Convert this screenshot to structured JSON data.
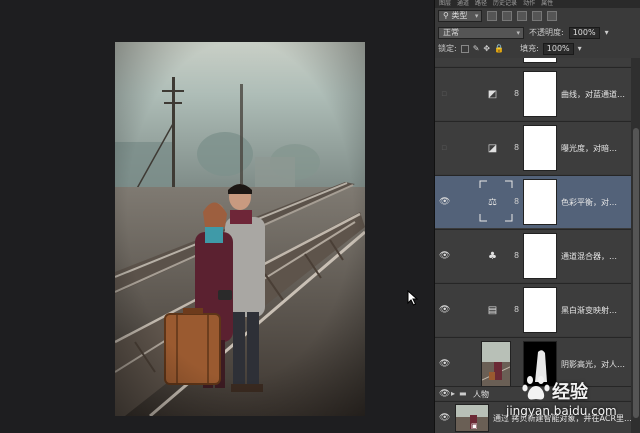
{
  "panel": {
    "tabs": [
      "图层",
      "通道",
      "路径",
      "历史记录",
      "动作",
      "属性"
    ],
    "filter_kind": "类型",
    "blend_mode": "正常",
    "opacity_label": "不透明度:",
    "opacity_value": "100%",
    "lock_label": "锁定:",
    "fill_label": "填充:",
    "fill_value": "100%"
  },
  "layers": [
    {
      "name": "曲线，对蓝通道…",
      "icon": "curves-icon",
      "visible": false,
      "selected": false
    },
    {
      "name": "曝光度，对暗…",
      "icon": "exposure-icon",
      "visible": false,
      "selected": false
    },
    {
      "name": "色彩平衡，对…",
      "icon": "color-balance-icon",
      "visible": true,
      "selected": true
    },
    {
      "name": "通道混合器，…",
      "icon": "channel-mixer-icon",
      "visible": true,
      "selected": false
    },
    {
      "name": "黑白渐变映射…",
      "icon": "gradient-map-icon",
      "visible": true,
      "selected": false
    },
    {
      "name": "阴影高光，对人…",
      "icon": "photo-thumbnail",
      "visible": true,
      "selected": false
    }
  ],
  "group": {
    "name": "人物"
  },
  "smart_layer": {
    "name": "通过 拷贝新建智能对象，并在ACR里…"
  },
  "watermark": {
    "brand": "经验",
    "url": "jingyan.baidu.com"
  },
  "colors": {
    "selected_layer": "#536279",
    "panel_bg": "#3a3a3a",
    "canvas_bg": "#1e1e20"
  }
}
